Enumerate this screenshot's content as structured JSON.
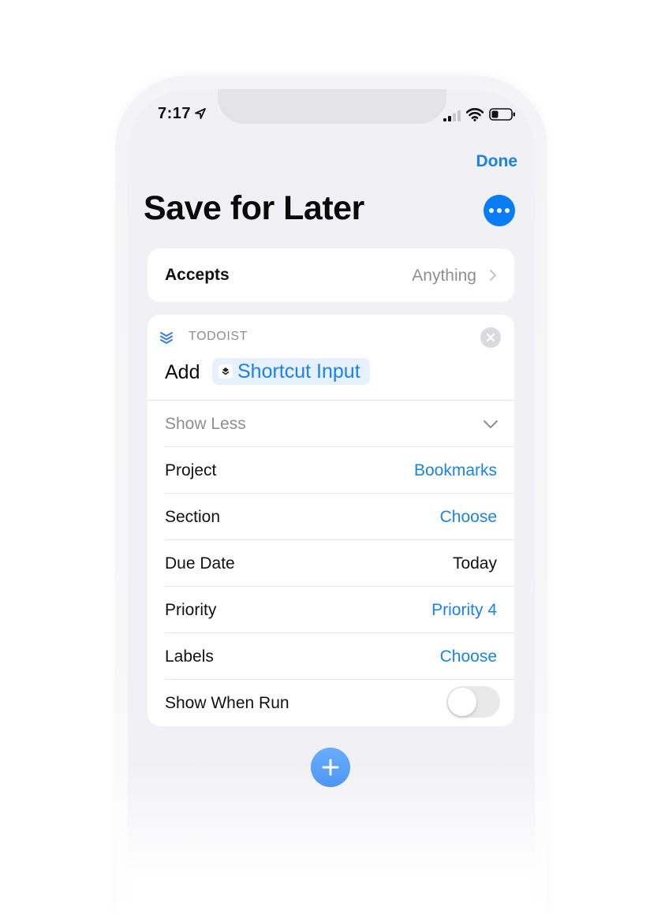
{
  "status_bar": {
    "time": "7:17"
  },
  "nav": {
    "done_label": "Done"
  },
  "shortcut": {
    "title": "Save for Later"
  },
  "accepts": {
    "label": "Accepts",
    "value": "Anything"
  },
  "action": {
    "app_name": "TODOIST",
    "verb": "Add",
    "variable": "Shortcut Input",
    "show_less_label": "Show Less",
    "rows": [
      {
        "label": "Project",
        "value": "Bookmarks",
        "style": "blue"
      },
      {
        "label": "Section",
        "value": "Choose",
        "style": "blue"
      },
      {
        "label": "Due Date",
        "value": "Today",
        "style": "black"
      },
      {
        "label": "Priority",
        "value": "Priority 4",
        "style": "blue"
      },
      {
        "label": "Labels",
        "value": "Choose",
        "style": "blue"
      }
    ],
    "show_when_run": {
      "label": "Show When Run",
      "enabled": false
    }
  },
  "colors": {
    "accent": "#1a82e8",
    "more_button": "#0a7cf5",
    "background": "#f1f1f5"
  },
  "icons": [
    "location-arrow-icon",
    "cellular-signal-icon",
    "wifi-icon",
    "battery-icon",
    "ellipsis-icon",
    "chevron-right-icon",
    "todoist-icon",
    "close-icon",
    "shortcut-input-icon",
    "chevron-down-icon",
    "plus-icon"
  ]
}
